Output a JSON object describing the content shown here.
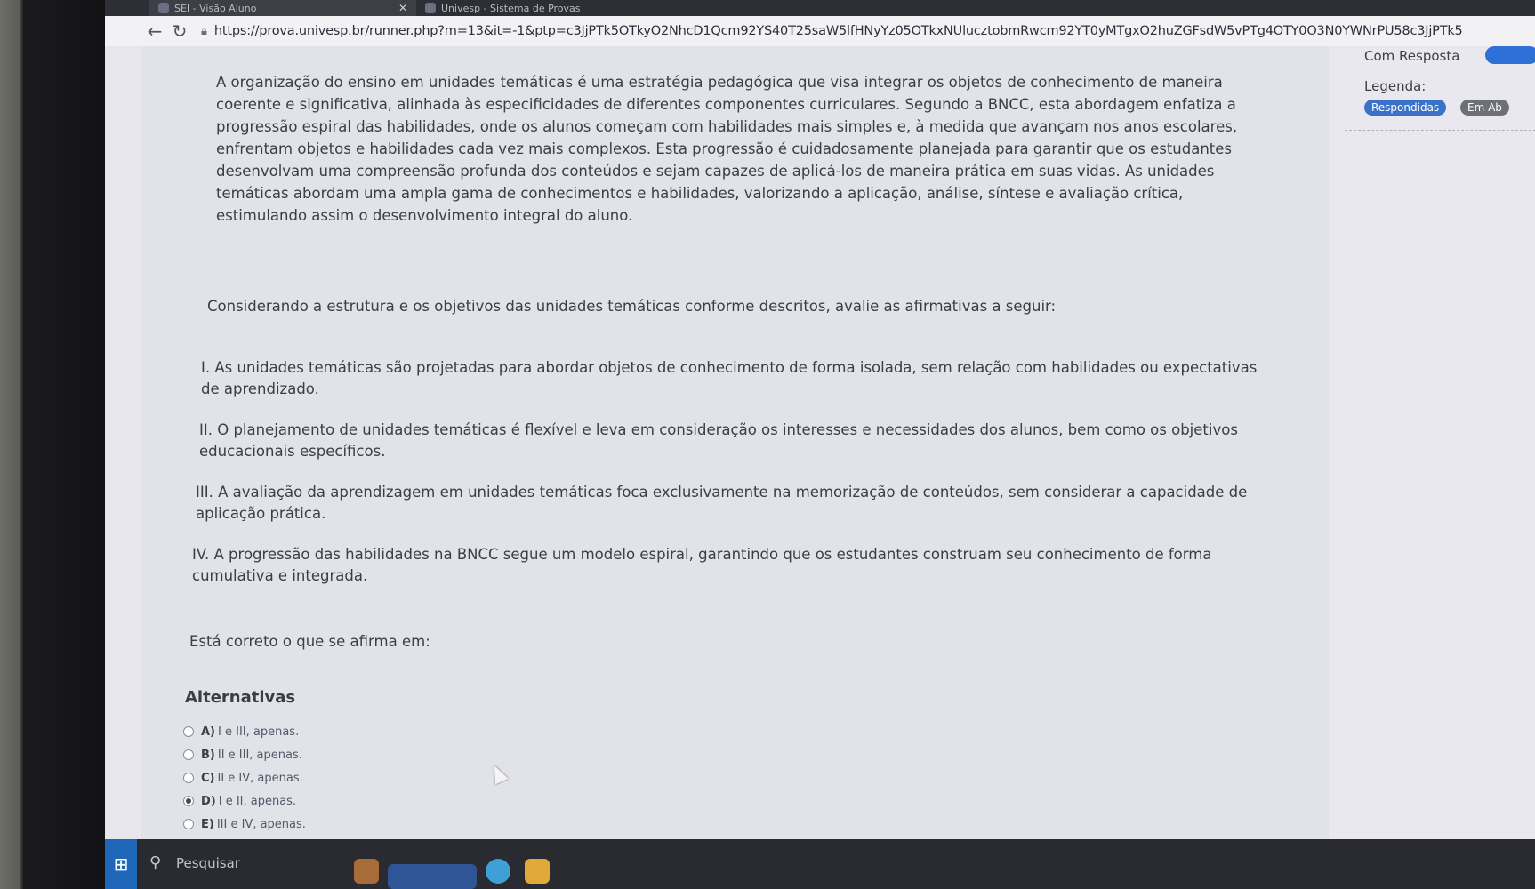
{
  "browser": {
    "tabs": [
      {
        "title": "SEI - Visão Aluno"
      },
      {
        "title": "Univesp - Sistema de Provas"
      }
    ],
    "url": "https://prova.univesp.br/runner.php?m=13&it=-1&ptp=c3JjPTk5OTkyO2NhcD1Qcm92YS40T25saW5lfHNyYz05OTkxNUlucztobmRwcm92YT0yMTgxO2huZGFsdW5vPTg4OTY0O3N0YWNrPU58c3JjPTk5"
  },
  "question": {
    "intro": "A organização do ensino em unidades temáticas é uma estratégia pedagógica que visa integrar os objetos de conhecimento de maneira coerente e significativa, alinhada às especificidades de diferentes componentes curriculares. Segundo a BNCC, esta abordagem enfatiza a progressão espiral das habilidades, onde os alunos começam com habilidades mais simples e, à medida que avançam nos anos escolares, enfrentam objetos e habilidades cada vez mais complexos. Esta progressão é cuidadosamente planejada para garantir que os estudantes desenvolvam uma compreensão profunda dos conteúdos e sejam capazes de aplicá-los de maneira prática em suas vidas. As unidades temáticas abordam uma ampla gama de conhecimentos e habilidades, valorizando a aplicação, análise, síntese e avaliação crítica, estimulando assim o desenvolvimento integral do aluno.",
    "prompt": "Considerando a estrutura e os objetivos das unidades temáticas conforme descritos, avalie as afirmativas a seguir:",
    "statements": [
      "I. As unidades temáticas são projetadas para abordar objetos de conhecimento de forma isolada, sem relação com habilidades ou expectativas de aprendizado.",
      "II. O planejamento de unidades temáticas é flexível e leva em consideração os interesses e necessidades dos alunos, bem como os objetivos educacionais específicos.",
      "III. A avaliação da aprendizagem em unidades temáticas foca exclusivamente na memorização de conteúdos, sem considerar a capacidade de aplicação prática.",
      "IV. A progressão das habilidades na BNCC segue um modelo espiral, garantindo que os estudantes construam seu conhecimento de forma cumulativa e integrada."
    ],
    "closing": "Está correto o que se afirma em:",
    "alternatives_title": "Alternativas",
    "alternatives": [
      {
        "letter": "A)",
        "text": "I e III, apenas.",
        "selected": false
      },
      {
        "letter": "B)",
        "text": "II e III, apenas.",
        "selected": false
      },
      {
        "letter": "C)",
        "text": "II e IV, apenas.",
        "selected": false
      },
      {
        "letter": "D)",
        "text": "I e II, apenas.",
        "selected": true
      },
      {
        "letter": "E)",
        "text": "III e IV, apenas.",
        "selected": false
      }
    ]
  },
  "sidebar": {
    "title": "Com Resposta",
    "legend_label": "Legenda:",
    "badge_answered": "Respondidas",
    "badge_open": "Em Ab"
  },
  "taskbar": {
    "search_label": "Pesquisar"
  }
}
